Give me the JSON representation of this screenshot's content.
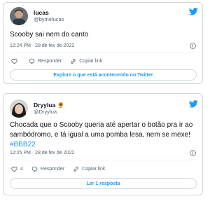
{
  "colors": {
    "accent": "#1d9bf0",
    "text": "#0f1419",
    "muted": "#536471",
    "border": "#cfd9de"
  },
  "tweets": [
    {
      "name": "lucas",
      "handle": "@bymelucas",
      "text": "Scooby sai nem do canto",
      "timestamp": "12:24 PM · 28 de fev de 2022",
      "reply_label": "Responder",
      "copy_label": "Copiar link",
      "footer_button": "Explore o que está acontecendo no Twitter",
      "icons": [
        "twitter-bird-icon",
        "info-icon",
        "heart-icon",
        "reply-icon",
        "link-icon"
      ]
    },
    {
      "name": "Dryylua 🌻",
      "handle": "@Dryylua",
      "text": "Chocada que o Scooby queria até apertar o botão pra ir ao sambódromo, e tá igual a uma pomba lesa, nem se mexe! ",
      "hashtag": "#BBB22",
      "timestamp": "12:25 PM · 28 de fev de 2022",
      "like_count": "4",
      "reply_label": "Responder",
      "copy_label": "Copiar link",
      "footer_button": "Ler 1 resposta",
      "icons": [
        "twitter-bird-icon",
        "info-icon",
        "heart-icon",
        "reply-icon",
        "link-icon"
      ]
    }
  ]
}
